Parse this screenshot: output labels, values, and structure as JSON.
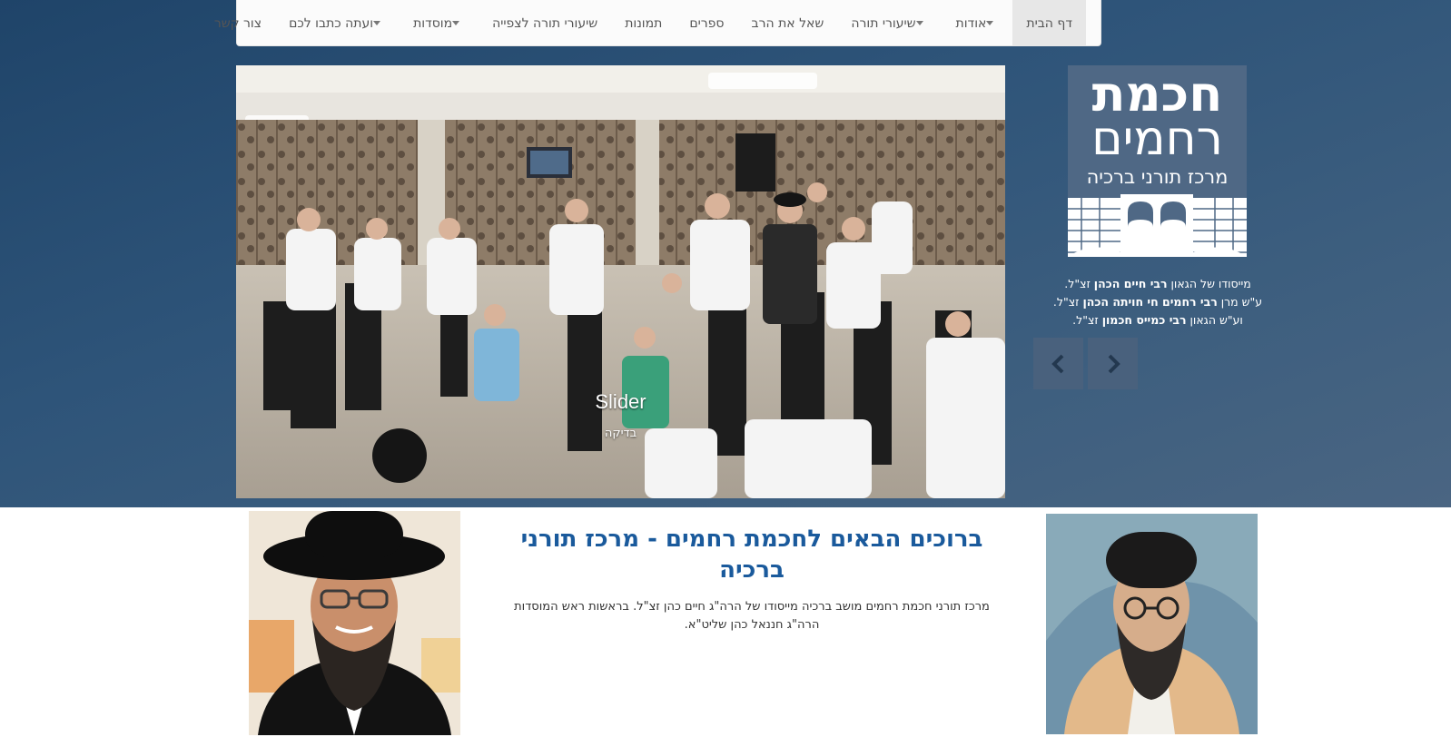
{
  "nav": {
    "items": [
      {
        "label": "דף הבית",
        "active": true,
        "dropdown": false
      },
      {
        "label": "אודות",
        "active": false,
        "dropdown": true
      },
      {
        "label": "שיעורי תורה",
        "active": false,
        "dropdown": true
      },
      {
        "label": "שאל את הרב",
        "active": false,
        "dropdown": false
      },
      {
        "label": "ספרים",
        "active": false,
        "dropdown": false
      },
      {
        "label": "תמונות",
        "active": false,
        "dropdown": false
      },
      {
        "label": "שיעורי תורה לצפייה",
        "active": false,
        "dropdown": false
      },
      {
        "label": "מוסדות",
        "active": false,
        "dropdown": true
      },
      {
        "label": "ועתה כתבו לכם",
        "active": false,
        "dropdown": true
      },
      {
        "label": "צור קשר",
        "active": false,
        "dropdown": false
      }
    ]
  },
  "slider": {
    "title": "Slider",
    "subtitle": "בדיקה"
  },
  "logo": {
    "line1": "חכמת",
    "line2": "רחמים",
    "line3": "מרכז תורני ברכיה"
  },
  "founders": {
    "line1_pre": "מייסודו של הגאון ",
    "line1_name": "רבי חיים הכהן",
    "line1_post": " זצ\"ל.",
    "line2_pre": "ע\"ש מרן ",
    "line2_name": "רבי רחמים חי חויתה הכהן",
    "line2_post": " זצ\"ל.",
    "line3_pre": "וע\"ש הגאון ",
    "line3_name": "רבי כמייס חכמון",
    "line3_post": " זצ\"ל."
  },
  "welcome": {
    "title": "ברוכים הבאים לחכמת רחמים - מרכז תורני ברכיה",
    "body": "מרכז תורני חכמת רחמים מושב ברכיה מייסודו של הרה\"ג חיים כהן זצ\"ל. בראשות ראש המוסדות הרה\"ג חננאל כהן שליט\"א."
  },
  "colors": {
    "hero_bg": "#2e5479",
    "accent_title": "#1a5a9c",
    "logo_bg": "#4f6885"
  }
}
